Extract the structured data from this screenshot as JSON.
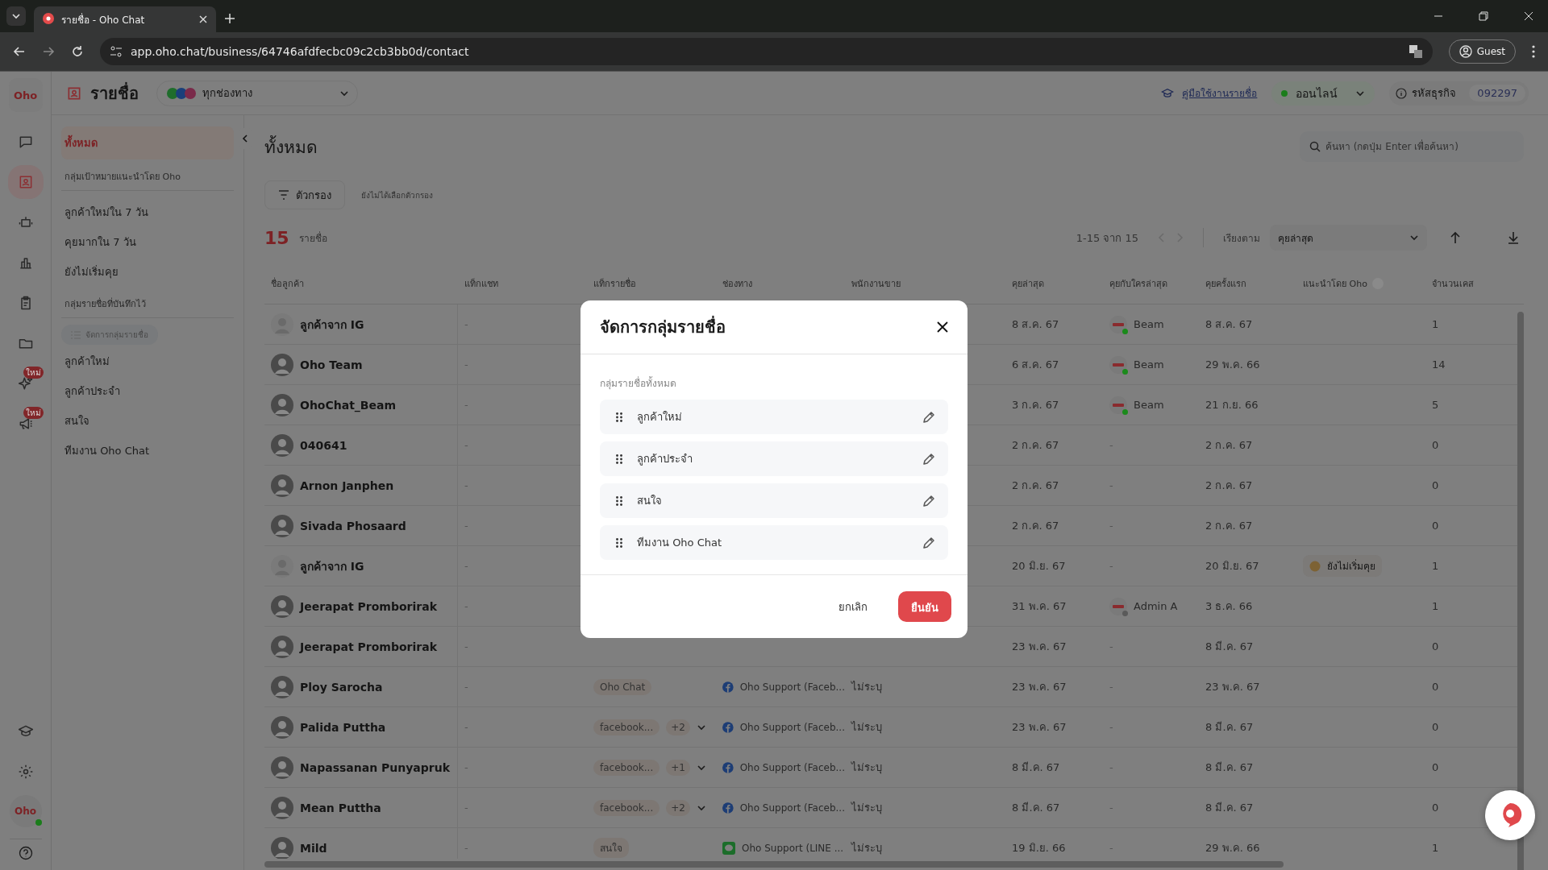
{
  "browser": {
    "tab_title": "รายชื่อ - Oho Chat",
    "url": "app.oho.chat/business/64746afdfecbc09c2cb3bb0d/contact",
    "profile": "Guest"
  },
  "rail": {
    "logo_text": "Oho",
    "items": [
      {
        "selected": false
      },
      {
        "selected": true
      },
      {
        "selected": false
      },
      {
        "selected": false
      },
      {
        "selected": false
      },
      {
        "selected": false
      },
      {
        "selected": false,
        "badge": "ใหม่"
      },
      {
        "selected": false,
        "badge": "ใหม่"
      }
    ],
    "account": {
      "logo_text": "Oho",
      "online": true
    }
  },
  "header": {
    "title": "รายชื่อ",
    "channel_filter": "ทุกช่องทาง",
    "guide_link": "คู่มือใช้งานรายชื่อ",
    "status": {
      "label": "ออนไลน์",
      "online": true
    },
    "business_id_label": "รหัสธุรกิจ",
    "business_id": "092297"
  },
  "sidebar": {
    "items": [
      {
        "kind": "item",
        "label": "ทั้งหมด",
        "selected": true
      },
      {
        "kind": "section",
        "label": "กลุ่มเป้าหมายแนะนำโดย Oho"
      },
      {
        "kind": "item",
        "label": "ลูกค้าใหม่ใน 7 วัน",
        "selected": false
      },
      {
        "kind": "item",
        "label": "คุยมากใน 7 วัน",
        "selected": false
      },
      {
        "kind": "item",
        "label": "ยังไม่เริ่มคุย",
        "selected": false
      },
      {
        "kind": "section",
        "label": "กลุ่มรายชื่อที่บันทึกไว้"
      },
      {
        "kind": "manage",
        "label": "จัดการกลุ่มรายชื่อ"
      },
      {
        "kind": "item",
        "label": "ลูกค้าใหม่",
        "selected": false
      },
      {
        "kind": "item",
        "label": "ลูกค้าประจำ",
        "selected": false
      },
      {
        "kind": "item",
        "label": "สนใจ",
        "selected": false
      },
      {
        "kind": "item",
        "label": "ทีมงาน Oho Chat",
        "selected": false
      }
    ]
  },
  "main": {
    "title": "ทั้งหมด",
    "search_placeholder": "ค้นหา (กดปุ่ม Enter เพื่อค้นหา)",
    "filter_button": "ตัวกรอง",
    "filter_status": "ยังไม่ได้เลือกตัวกรอง",
    "count": "15",
    "count_unit": "รายชื่อ",
    "pagination": "1-15 จาก 15",
    "sort_label": "เรียงตาม",
    "sort_value": "คุยล่าสุด"
  },
  "table": {
    "columns": [
      "ชื่อลูกค้า",
      "แท็กแชท",
      "แท็กรายชื่อ",
      "ช่องทาง",
      "พนักงานขาย",
      "คุยล่าสุด",
      "คุยกับใครล่าสุด",
      "คุยครั้งแรก",
      "แนะนำโดย Oho",
      "จำนวนเคส"
    ],
    "rows": [
      {
        "name": "ลูกค้าจาก IG",
        "kind": "default",
        "chat_tag": "-",
        "last_chat": "8 ส.ค. 67",
        "last_agent": {
          "kind": "agent",
          "name": "Beam",
          "online": true
        },
        "first_chat": "8 ส.ค. 67",
        "cases": "1"
      },
      {
        "name": "Oho Team",
        "kind": "photo",
        "chat_tag": "-",
        "last_chat": "6 ส.ค. 67",
        "last_agent": {
          "kind": "agent",
          "name": "Beam",
          "online": true
        },
        "first_chat": "29 พ.ค. 66",
        "cases": "14"
      },
      {
        "name": "OhoChat_Beam",
        "kind": "photo",
        "chat_tag": "-",
        "last_chat": "3 ก.ค. 67",
        "last_agent": {
          "kind": "agent",
          "name": "Beam",
          "online": true
        },
        "first_chat": "21 ก.ย. 66",
        "cases": "5"
      },
      {
        "name": "040641",
        "kind": "photo",
        "chat_tag": "-",
        "last_chat": "2 ก.ค. 67",
        "last_agent": {
          "kind": "none",
          "text": "-"
        },
        "first_chat": "2 ก.ค. 67",
        "cases": "0"
      },
      {
        "name": "Arnon Janphen",
        "kind": "photo",
        "chat_tag": "-",
        "last_chat": "2 ก.ค. 67",
        "last_agent": {
          "kind": "none",
          "text": "-"
        },
        "first_chat": "2 ก.ค. 67",
        "cases": "0"
      },
      {
        "name": "Sivada Phosaard",
        "kind": "photo",
        "chat_tag": "-",
        "last_chat": "2 ก.ค. 67",
        "last_agent": {
          "kind": "none",
          "text": "-"
        },
        "first_chat": "2 ก.ค. 67",
        "cases": "0"
      },
      {
        "name": "ลูกค้าจาก IG",
        "kind": "default",
        "chat_tag": "-",
        "last_chat": "20 มิ.ย. 67",
        "last_agent": {
          "kind": "none",
          "text": "-"
        },
        "first_chat": "20 มิ.ย. 67",
        "recommended": "ยังไม่เริ่มคุย",
        "cases": "1"
      },
      {
        "name": "Jeerapat Promborirak",
        "kind": "photo",
        "chat_tag": "-",
        "last_chat": "31 พ.ค. 67",
        "last_agent": {
          "kind": "agent",
          "name": "Admin A",
          "online": false
        },
        "first_chat": "3 ธ.ค. 66",
        "cases": "1"
      },
      {
        "name": "Jeerapat Promborirak",
        "kind": "photo",
        "chat_tag": "-",
        "last_chat": "23 พ.ค. 67",
        "last_agent": {
          "kind": "none",
          "text": "-"
        },
        "first_chat": "8 มี.ค. 67",
        "cases": "0"
      },
      {
        "name": "Ploy Sarocha",
        "kind": "photo",
        "chat_tag": "-",
        "contact_tags": [
          "Oho Chat"
        ],
        "channel": {
          "kind": "facebook",
          "name": "Oho Support (Faceb..."
        },
        "sales": "ไม่ระบุ",
        "last_chat": "23 พ.ค. 67",
        "last_agent": {
          "kind": "none",
          "text": "-"
        },
        "first_chat": "23 พ.ค. 67",
        "cases": "0"
      },
      {
        "name": "Palida Puttha",
        "kind": "photo",
        "chat_tag": "-",
        "contact_tags": [
          "facebook..."
        ],
        "more_tags": "+2",
        "channel": {
          "kind": "facebook",
          "name": "Oho Support (Faceb..."
        },
        "sales": "ไม่ระบุ",
        "last_chat": "23 พ.ค. 67",
        "last_agent": {
          "kind": "none",
          "text": "-"
        },
        "first_chat": "8 มี.ค. 67",
        "cases": "0"
      },
      {
        "name": "Napassanan Punyapruk",
        "kind": "photo",
        "chat_tag": "-",
        "contact_tags": [
          "facebook..."
        ],
        "more_tags": "+1",
        "channel": {
          "kind": "facebook",
          "name": "Oho Support (Faceb..."
        },
        "sales": "ไม่ระบุ",
        "last_chat": "8 มี.ค. 67",
        "last_agent": {
          "kind": "none",
          "text": "-"
        },
        "first_chat": "8 มี.ค. 67",
        "cases": "0"
      },
      {
        "name": "Mean Puttha",
        "kind": "photo",
        "chat_tag": "-",
        "contact_tags": [
          "facebook..."
        ],
        "more_tags": "+2",
        "channel": {
          "kind": "facebook",
          "name": "Oho Support (Faceb..."
        },
        "sales": "ไม่ระบุ",
        "last_chat": "8 มี.ค. 67",
        "last_agent": {
          "kind": "none",
          "text": "-"
        },
        "first_chat": "8 มี.ค. 67",
        "cases": "0"
      },
      {
        "name": "Mild",
        "kind": "photo",
        "chat_tag": "-",
        "contact_tags": [
          "สนใจ"
        ],
        "channel": {
          "kind": "line",
          "name": "Oho Support (LINE ..."
        },
        "sales": "ไม่ระบุ",
        "last_chat": "19 มิ.ย. 66",
        "last_agent": {
          "kind": "none",
          "text": "-"
        },
        "first_chat": "29 พ.ค. 66",
        "cases": "1"
      }
    ]
  },
  "modal": {
    "title": "จัดการกลุ่มรายชื่อ",
    "list_label": "กลุ่มรายชื่อทั้งหมด",
    "groups": [
      "ลูกค้าใหม่",
      "ลูกค้าประจำ",
      "สนใจ",
      "ทีมงาน Oho Chat"
    ],
    "cancel": "ยกเลิก",
    "confirm": "ยืนยัน"
  }
}
